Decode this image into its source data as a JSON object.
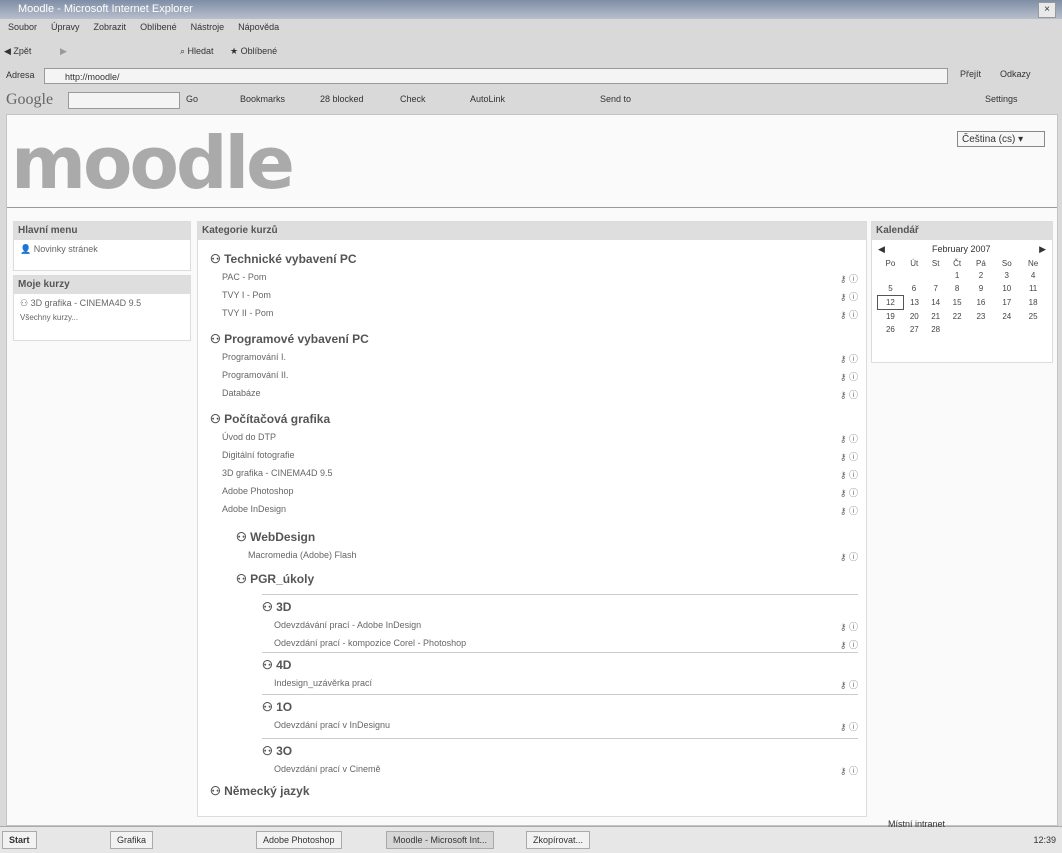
{
  "window": {
    "title": "Moodle - Microsoft Internet Explorer"
  },
  "menubar": [
    "Soubor",
    "Úpravy",
    "Zobrazit",
    "Oblíbené",
    "Nástroje",
    "Nápověda"
  ],
  "toolbar": {
    "back": "Zpět",
    "search": "Hledat",
    "favorites": "Oblíbené"
  },
  "address": {
    "label": "Adresa",
    "url": "http://moodle/",
    "go": "Přejít",
    "links": "Odkazy"
  },
  "google": {
    "logo": "Google",
    "go": "Go",
    "bookmarks": "Bookmarks",
    "blocked": "28 blocked",
    "check": "Check",
    "autolink": "AutoLink",
    "sendto": "Send to",
    "settings": "Settings"
  },
  "header": {
    "logo": "moodle",
    "language": "Čeština (cs)"
  },
  "mainmenu": {
    "title": "Hlavní menu",
    "items": [
      "Novinky stránek"
    ]
  },
  "mycourses": {
    "title": "Moje kurzy",
    "items": [
      "3D grafika - CINEMA4D 9.5"
    ],
    "all": "Všechny kurzy..."
  },
  "categories": {
    "title": "Kategorie kurzů",
    "groups": [
      {
        "name": "Technické vybavení PC",
        "courses": [
          "PAC - Pom",
          "TVY I - Pom",
          "TVY II - Pom"
        ]
      },
      {
        "name": "Programové vybavení PC",
        "courses": [
          "Programování I.",
          "Programování II.",
          "Databáze"
        ]
      },
      {
        "name": "Počítačová grafika",
        "courses": [
          "Úvod do DTP",
          "Digitální fotografie",
          "3D grafika - CINEMA4D 9.5",
          "Adobe Photoshop",
          "Adobe InDesign"
        ]
      },
      {
        "name": "WebDesign",
        "courses": [
          "Macromedia (Adobe) Flash"
        ]
      },
      {
        "name": "PGR_úkoly",
        "courses": []
      },
      {
        "name": "3D",
        "courses": [
          "Odevzdávání prací - Adobe InDesign",
          "Odevzdání prací - kompozice Corel - Photoshop"
        ]
      },
      {
        "name": "4D",
        "courses": [
          "Indesign_uzávěrka prací"
        ]
      },
      {
        "name": "1O",
        "courses": [
          "Odevzdání prací v InDesignu"
        ]
      },
      {
        "name": "3O",
        "courses": [
          "Odevzdání prací v Cinemě"
        ]
      },
      {
        "name": "Německý jazyk",
        "courses": []
      }
    ]
  },
  "calendar": {
    "title": "Kalendář",
    "month": "February 2007",
    "weekdays": [
      "Po",
      "Út",
      "St",
      "Čt",
      "Pá",
      "So",
      "Ne"
    ],
    "weeks": [
      [
        "",
        "",
        "",
        "1",
        "2",
        "3",
        "4"
      ],
      [
        "5",
        "6",
        "7",
        "8",
        "9",
        "10",
        "11"
      ],
      [
        "12",
        "13",
        "14",
        "15",
        "16",
        "17",
        "18"
      ],
      [
        "19",
        "20",
        "21",
        "22",
        "23",
        "24",
        "25"
      ],
      [
        "26",
        "27",
        "28",
        "",
        "",
        "",
        ""
      ]
    ],
    "today": "12"
  },
  "statusbar": {
    "zone": "Místní intranet"
  },
  "taskbar": {
    "start": "Start",
    "items": [
      "Grafika",
      "Adobe Photoshop",
      "Moodle - Microsoft Int...",
      "Zkopírovat..."
    ],
    "clock": "12:39"
  }
}
